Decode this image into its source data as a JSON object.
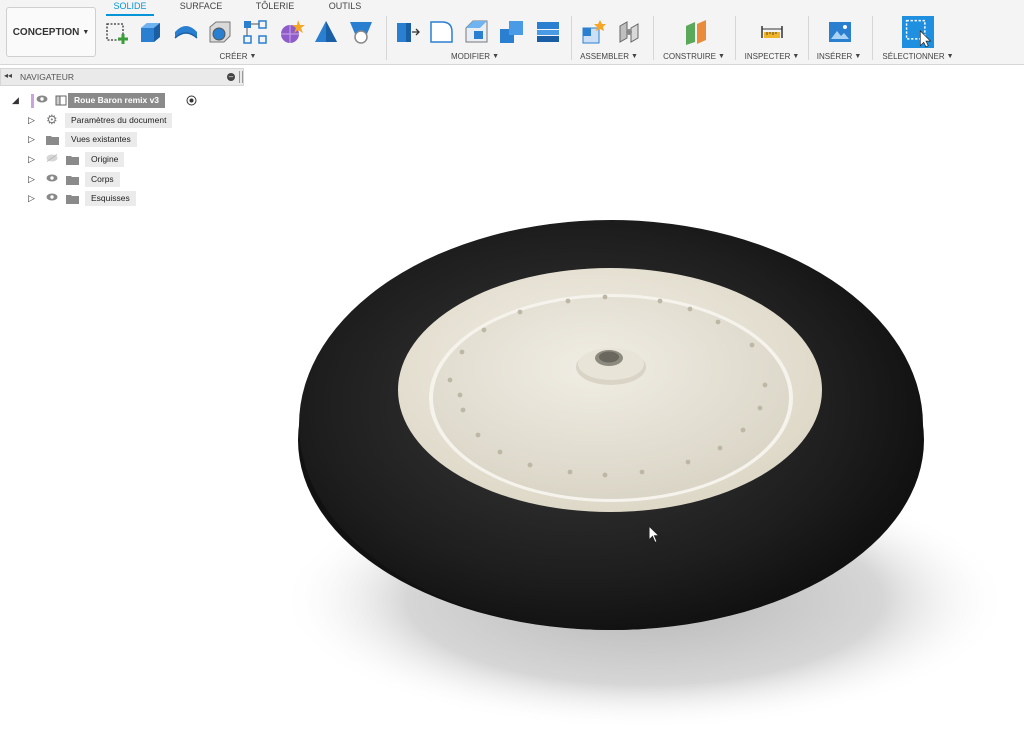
{
  "workspace": {
    "label": "CONCEPTION"
  },
  "tabs": [
    {
      "label": "SOLIDE",
      "active": true
    },
    {
      "label": "SURFACE",
      "active": false
    },
    {
      "label": "TÔLERIE",
      "active": false
    },
    {
      "label": "OUTILS",
      "active": false
    }
  ],
  "toolbar": {
    "groups": [
      {
        "label": "CRÉER",
        "icons": [
          "create-sketch-icon",
          "extrude-icon",
          "revolve-icon",
          "hole-icon",
          "rectangular-pattern-icon",
          "create-form-icon",
          "loft-icon",
          "sweep-icon"
        ]
      },
      {
        "label": "MODIFIER",
        "icons": [
          "press-pull-icon",
          "fillet-icon",
          "chamfer-icon",
          "combine-icon",
          "shell-icon"
        ]
      },
      {
        "label": "ASSEMBLER",
        "icons": [
          "new-component-icon",
          "joint-icon"
        ]
      },
      {
        "label": "CONSTRUIRE",
        "icons": [
          "offset-plane-icon"
        ]
      },
      {
        "label": "INSPECTER",
        "icons": [
          "measure-icon"
        ]
      },
      {
        "label": "INSÉRER",
        "icons": [
          "insert-image-icon"
        ]
      },
      {
        "label": "SÉLECTIONNER",
        "icons": [
          "select-icon"
        ]
      }
    ],
    "accent_color": "#0696d7"
  },
  "navigator": {
    "title": "NAVIGATEUR",
    "root": {
      "label": "Roue Baron remix v3"
    },
    "items": [
      {
        "label": "Paramètres du document",
        "icon": "gear-icon"
      },
      {
        "label": "Vues existantes",
        "icon": "folder-icon"
      },
      {
        "label": "Origine",
        "icon": "folder-icon",
        "visible": false
      },
      {
        "label": "Corps",
        "icon": "folder-icon",
        "visible": true
      },
      {
        "label": "Esquisses",
        "icon": "folder-icon",
        "visible": true
      }
    ]
  },
  "model": {
    "tire_color": "#1c1c1c",
    "rim_color": "#ece8dc",
    "hub_color": "#ddd8ca"
  }
}
